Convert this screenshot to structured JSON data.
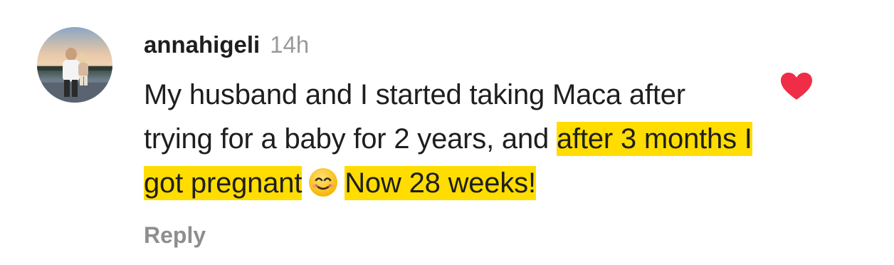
{
  "comment": {
    "username": "annahigeli",
    "time": "14h",
    "text_part_1": "My husband and I started taking Maca after trying for a baby for 2 years, and ",
    "text_highlight_1": "after 3 months I got pregnant",
    "emoji": "smiling-face-emoji",
    "text_highlight_2": "Now 28 weeks!",
    "reply_label": "Reply",
    "liked": true,
    "icons": {
      "like": "heart-icon",
      "avatar": "avatar"
    },
    "colors": {
      "highlight": "#ffdd00",
      "like": "#ef2d47",
      "secondary_text": "#8e8e8e"
    }
  }
}
